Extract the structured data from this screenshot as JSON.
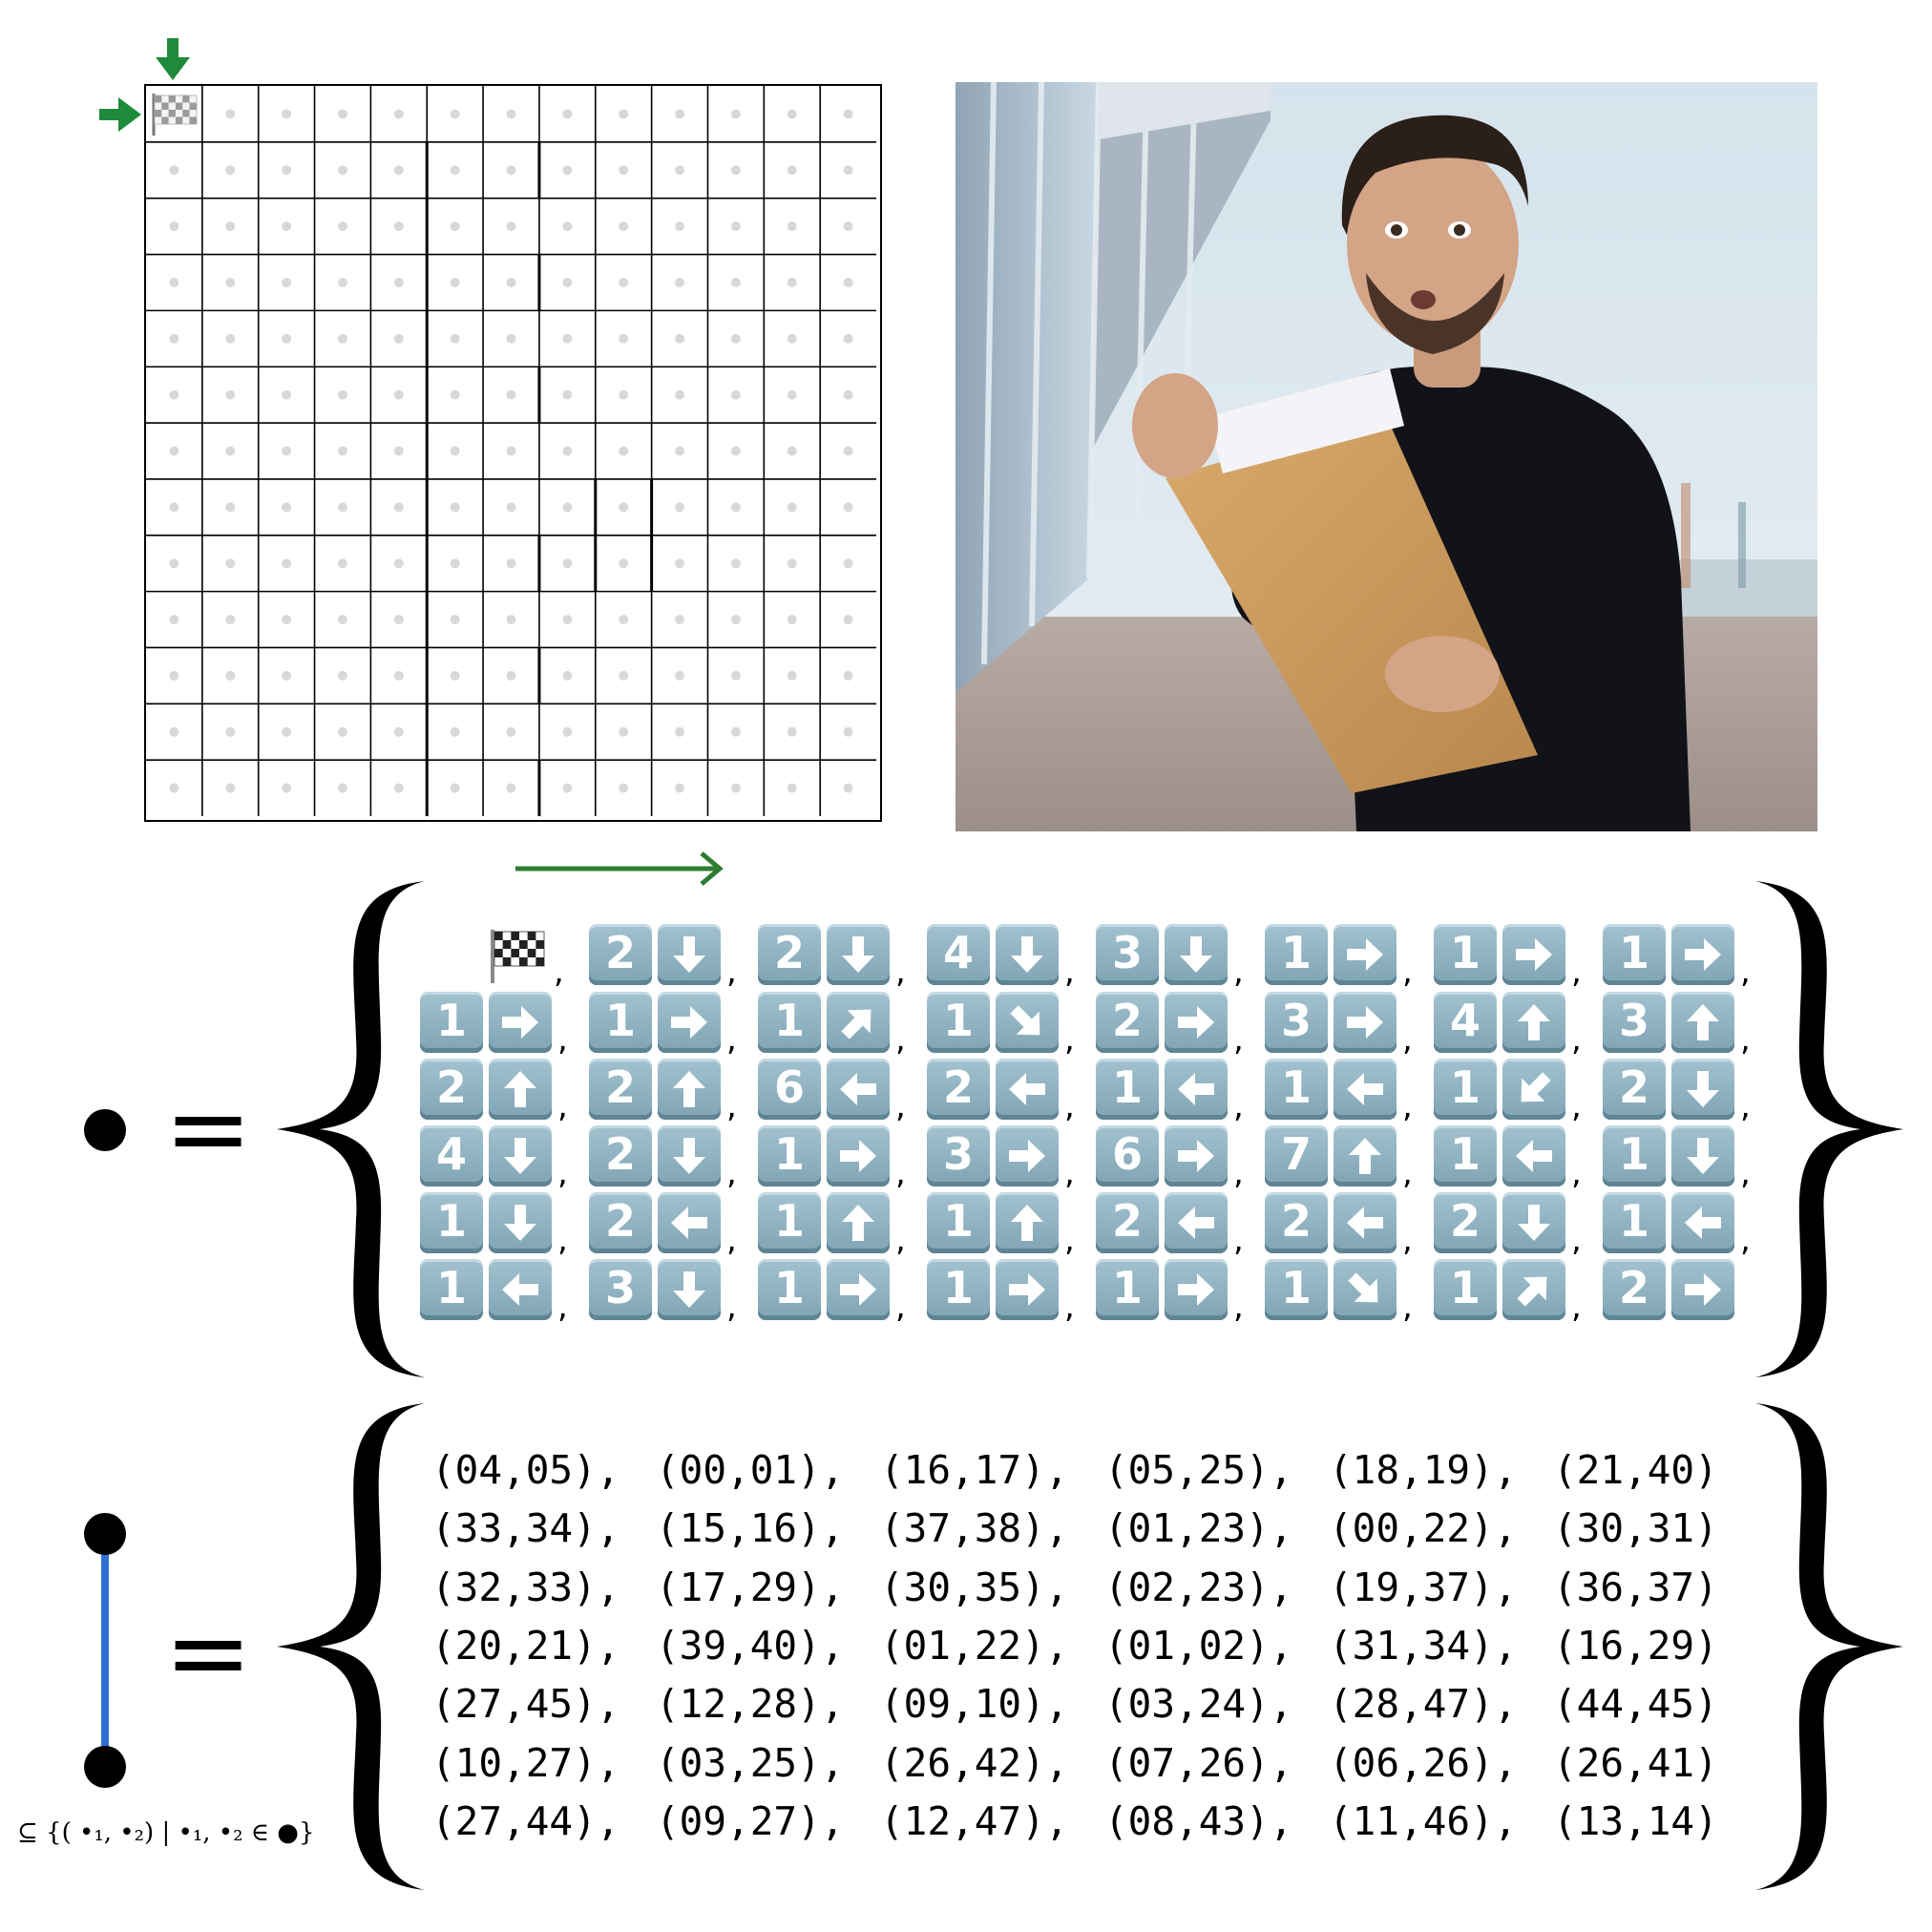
{
  "grid": {
    "rows": 13,
    "cols": 13,
    "start_cell": [
      0,
      0
    ],
    "start_icon": "checkered-flag-icon",
    "entry_arrows": [
      "down-arrow-icon",
      "right-arrow-icon"
    ],
    "thick_walls_note": "walls bordering maze cells"
  },
  "photo": {
    "description_icon": "photo-man-opening-envelope"
  },
  "moves_legend": {
    "symbol": "node-dot-icon",
    "equals": "=",
    "direction_arrow": "right-arrow-icon",
    "start_icon": "checkered-flag-icon",
    "moves": [
      {
        "n": "2",
        "d": "down"
      },
      {
        "n": "2",
        "d": "down"
      },
      {
        "n": "4",
        "d": "down"
      },
      {
        "n": "3",
        "d": "down"
      },
      {
        "n": "1",
        "d": "right"
      },
      {
        "n": "1",
        "d": "right"
      },
      {
        "n": "1",
        "d": "right"
      },
      {
        "n": "1",
        "d": "right"
      },
      {
        "n": "1",
        "d": "right"
      },
      {
        "n": "1",
        "d": "up-right"
      },
      {
        "n": "1",
        "d": "down-right"
      },
      {
        "n": "2",
        "d": "right"
      },
      {
        "n": "3",
        "d": "right"
      },
      {
        "n": "4",
        "d": "up"
      },
      {
        "n": "3",
        "d": "up"
      },
      {
        "n": "2",
        "d": "up"
      },
      {
        "n": "2",
        "d": "up"
      },
      {
        "n": "6",
        "d": "left"
      },
      {
        "n": "2",
        "d": "left"
      },
      {
        "n": "1",
        "d": "left"
      },
      {
        "n": "1",
        "d": "left"
      },
      {
        "n": "1",
        "d": "down-left"
      },
      {
        "n": "2",
        "d": "down"
      },
      {
        "n": "4",
        "d": "down"
      },
      {
        "n": "2",
        "d": "down"
      },
      {
        "n": "1",
        "d": "right"
      },
      {
        "n": "3",
        "d": "right"
      },
      {
        "n": "6",
        "d": "right"
      },
      {
        "n": "7",
        "d": "up"
      },
      {
        "n": "1",
        "d": "left"
      },
      {
        "n": "1",
        "d": "down"
      },
      {
        "n": "1",
        "d": "down"
      },
      {
        "n": "2",
        "d": "left"
      },
      {
        "n": "1",
        "d": "up"
      },
      {
        "n": "1",
        "d": "up"
      },
      {
        "n": "2",
        "d": "left"
      },
      {
        "n": "2",
        "d": "left"
      },
      {
        "n": "2",
        "d": "down"
      },
      {
        "n": "1",
        "d": "left"
      },
      {
        "n": "1",
        "d": "left"
      },
      {
        "n": "3",
        "d": "down"
      },
      {
        "n": "1",
        "d": "right"
      },
      {
        "n": "1",
        "d": "right"
      },
      {
        "n": "1",
        "d": "right"
      },
      {
        "n": "1",
        "d": "down-right"
      },
      {
        "n": "1",
        "d": "up-right"
      },
      {
        "n": "2",
        "d": "right"
      }
    ]
  },
  "edges_legend": {
    "symbol": "edge-segment-icon",
    "equals": "=",
    "caption": "⊆ {( •₁, •₂) | •₁, •₂ ∈ ●}",
    "pairs": [
      [
        "(04,05),",
        "(00,01),",
        "(16,17),",
        "(05,25),",
        "(18,19),",
        "(21,40)"
      ],
      [
        "(33,34),",
        "(15,16),",
        "(37,38),",
        "(01,23),",
        "(00,22),",
        "(30,31)"
      ],
      [
        "(32,33),",
        "(17,29),",
        "(30,35),",
        "(02,23),",
        "(19,37),",
        "(36,37)"
      ],
      [
        "(20,21),",
        "(39,40),",
        "(01,22),",
        "(01,02),",
        "(31,34),",
        "(16,29)"
      ],
      [
        "(27,45),",
        "(12,28),",
        "(09,10),",
        "(03,24),",
        "(28,47),",
        "(44,45)"
      ],
      [
        "(10,27),",
        "(03,25),",
        "(26,42),",
        "(07,26),",
        "(06,26),",
        "(26,41)"
      ],
      [
        "(27,44),",
        "(09,27),",
        "(12,47),",
        "(08,43),",
        "(11,46),",
        "(13,14)"
      ]
    ]
  },
  "colors": {
    "green_arrow": "#1e7d2e",
    "key_face": "#8fb3c2",
    "edge_line": "#2f6fd6"
  }
}
